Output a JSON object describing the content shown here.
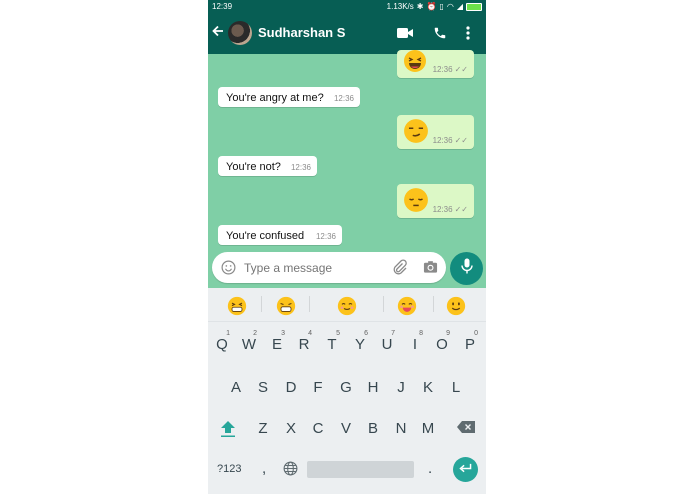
{
  "status_bar": {
    "time": "12:39",
    "speed": "1.13K/s"
  },
  "app_bar": {
    "contact_name": "Sudharshan S"
  },
  "chat": {
    "messages": [
      {
        "direction": "out",
        "emoji": "laughing",
        "time": "12:36",
        "ticks": "✓✓"
      },
      {
        "direction": "in",
        "text": "You're angry at me?",
        "time": "12:36"
      },
      {
        "direction": "out",
        "emoji": "smirking",
        "time": "12:36",
        "ticks": "✓✓"
      },
      {
        "direction": "in",
        "text": "You're not?",
        "time": "12:36"
      },
      {
        "direction": "out",
        "emoji": "pensive",
        "time": "12:36",
        "ticks": "✓✓"
      },
      {
        "direction": "in",
        "text": "You're confused",
        "time": "12:36"
      }
    ]
  },
  "input": {
    "placeholder": "Type a message"
  },
  "keyboard": {
    "emoji_suggestions": [
      "grinning-squinting",
      "grinning-squinting-laughing",
      "smiling-closed-eyes",
      "heart-eyes-blush",
      "smiling"
    ],
    "row1": [
      {
        "key": "Q",
        "hint": "1"
      },
      {
        "key": "W",
        "hint": "2"
      },
      {
        "key": "E",
        "hint": "3"
      },
      {
        "key": "R",
        "hint": "4"
      },
      {
        "key": "T",
        "hint": "5"
      },
      {
        "key": "Y",
        "hint": "6"
      },
      {
        "key": "U",
        "hint": "7"
      },
      {
        "key": "I",
        "hint": "8"
      },
      {
        "key": "O",
        "hint": "9"
      },
      {
        "key": "P",
        "hint": "0"
      }
    ],
    "row2": [
      "A",
      "S",
      "D",
      "F",
      "G",
      "H",
      "J",
      "K",
      "L"
    ],
    "row3": [
      "Z",
      "X",
      "C",
      "V",
      "B",
      "N",
      "M"
    ],
    "symbols_key": "?123",
    "comma_key": ",",
    "period_key": "."
  },
  "colors": {
    "header": "#075e54",
    "chat_background": "#7fcfa6",
    "outgoing_bubble": "#dcf8c6",
    "incoming_bubble": "#ffffff",
    "accent": "#128c7e",
    "keyboard_accent": "#26a69a"
  },
  "icons": {
    "status": [
      "bluetooth-icon",
      "alarm-icon",
      "vibrate-icon",
      "wifi-icon",
      "signal-icon",
      "battery-icon"
    ],
    "app_bar": [
      "back-arrow-icon",
      "video-call-icon",
      "phone-icon",
      "more-vert-icon"
    ],
    "input": [
      "emoji-icon",
      "attach-icon",
      "camera-icon",
      "mic-icon"
    ]
  }
}
